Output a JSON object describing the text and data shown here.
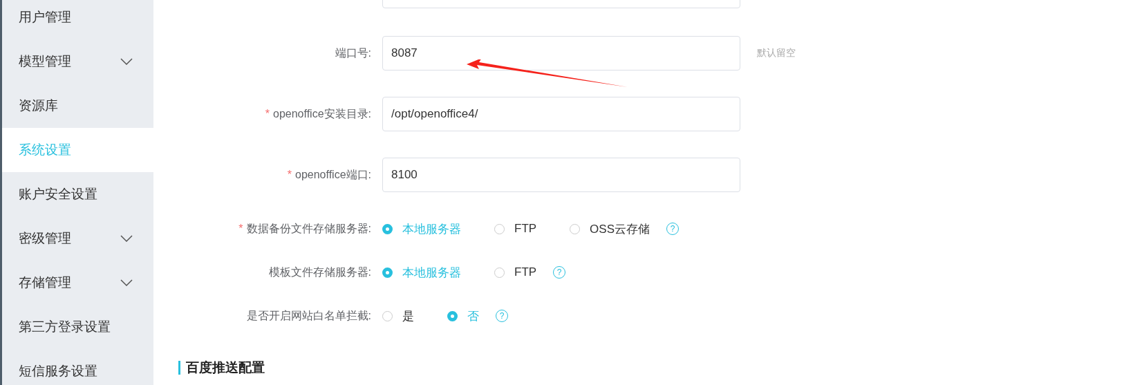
{
  "sidebar": {
    "items": [
      {
        "label": "用户管理",
        "expandable": false,
        "selected": false
      },
      {
        "label": "模型管理",
        "expandable": true,
        "selected": false
      },
      {
        "label": "资源库",
        "expandable": false,
        "selected": false
      },
      {
        "label": "系统设置",
        "expandable": false,
        "selected": true
      },
      {
        "label": "账户安全设置",
        "expandable": false,
        "selected": false
      },
      {
        "label": "密级管理",
        "expandable": true,
        "selected": false
      },
      {
        "label": "存储管理",
        "expandable": true,
        "selected": false
      },
      {
        "label": "第三方登录设置",
        "expandable": false,
        "selected": false
      },
      {
        "label": "短信服务设置",
        "expandable": false,
        "selected": false
      }
    ]
  },
  "form": {
    "fields": [
      {
        "kind": "input"
      },
      {
        "kind": "input",
        "label": "端口号:",
        "value": "8087",
        "hint": "默认留空"
      },
      {
        "kind": "input",
        "label": "openoffice安装目录:",
        "required_mark": "*",
        "value": "/opt/openoffice4/"
      },
      {
        "kind": "input",
        "label": "openoffice端口:",
        "required_mark": "*",
        "value": "8100"
      },
      {
        "kind": "radio",
        "label": "数据备份文件存储服务器:",
        "required_mark": "*",
        "help": "?",
        "options": [
          {
            "label": "本地服务器",
            "selected": true
          },
          {
            "label": "FTP",
            "selected": false
          },
          {
            "label": "OSS云存储",
            "selected": false
          }
        ]
      },
      {
        "kind": "radio",
        "label": "模板文件存储服务器:",
        "help": "?",
        "options": [
          {
            "label": "本地服务器",
            "selected": true
          },
          {
            "label": "FTP",
            "selected": false
          }
        ]
      },
      {
        "kind": "radio",
        "label": "是否开启网站白名单拦截:",
        "help": "?",
        "options": [
          {
            "label": "是",
            "selected": false
          },
          {
            "label": "否",
            "selected": true
          }
        ]
      }
    ]
  },
  "section": {
    "title": "百度推送配置"
  }
}
